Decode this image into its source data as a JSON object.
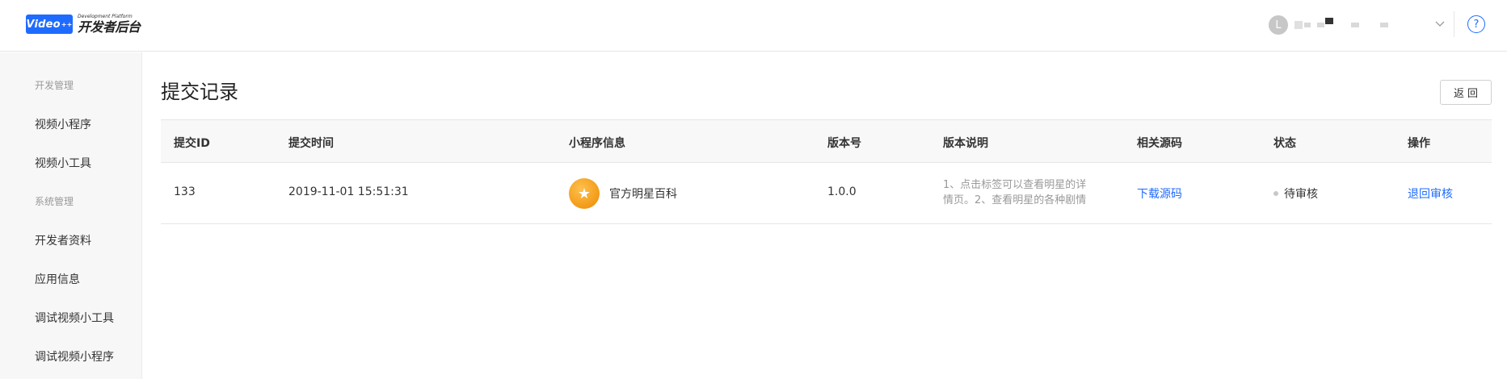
{
  "header": {
    "logo_badge": "Video",
    "logo_badge_sup": "++",
    "logo_subtitle": "Development Platform",
    "logo_title": "开发者后台",
    "user_initial": "L",
    "help_symbol": "?",
    "brand_color": "#1f6bff"
  },
  "sidebar": {
    "group_dev": "开发管理",
    "item_video_app": "视频小程序",
    "item_video_tool": "视频小工具",
    "group_system": "系统管理",
    "item_dev_profile": "开发者资料",
    "item_app_info": "应用信息",
    "item_debug_tool": "调试视频小工具",
    "item_debug_app": "调试视频小程序"
  },
  "main": {
    "title": "提交记录",
    "back_label": "返回",
    "columns": {
      "id": "提交ID",
      "time": "提交时间",
      "app_info": "小程序信息",
      "version": "版本号",
      "version_desc": "版本说明",
      "source": "相关源码",
      "status": "状态",
      "action": "操作"
    },
    "rows": [
      {
        "id": "133",
        "time": "2019-11-01 15:51:31",
        "app_icon": "star-icon",
        "app_name": "官方明星百科",
        "version": "1.0.0",
        "desc_line1": "1、点击标签可以查看明星的详",
        "desc_line2": "情页。2、查看明星的各种剧情",
        "source_link": "下载源码",
        "status": "待审核",
        "action_link": "退回审核"
      }
    ]
  }
}
